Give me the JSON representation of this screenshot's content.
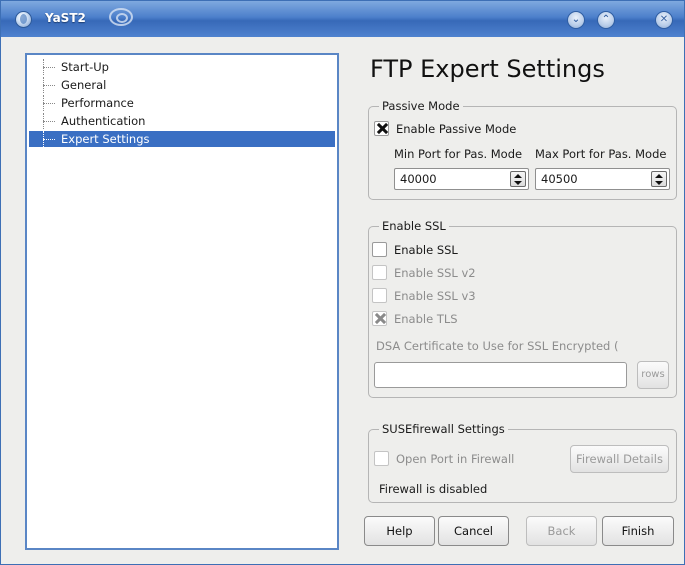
{
  "window": {
    "title": "YaST2"
  },
  "titlebar_buttons": {
    "minimize": "⌄",
    "maximize": "⌃",
    "close": "✕"
  },
  "tree": {
    "items": [
      {
        "label": "Start-Up",
        "selected": false
      },
      {
        "label": "General",
        "selected": false
      },
      {
        "label": "Performance",
        "selected": false
      },
      {
        "label": "Authentication",
        "selected": false
      },
      {
        "label": "Expert Settings",
        "selected": true
      }
    ]
  },
  "heading": "FTP Expert Settings",
  "passive_mode": {
    "group_title": "Passive Mode",
    "enable_label": "Enable Passive Mode",
    "enable_checked": true,
    "min_port_label": "Min Port for Pas. Mode",
    "min_port_value": "40000",
    "max_port_label": "Max Port for Pas. Mode",
    "max_port_value": "40500"
  },
  "ssl": {
    "group_title": "Enable SSL",
    "enable_ssl_label": "Enable SSL",
    "enable_ssl_checked": false,
    "ssl_v2_label": "Enable SSL v2",
    "ssl_v2_checked": false,
    "ssl_v3_label": "Enable SSL v3",
    "ssl_v3_checked": false,
    "tls_label": "Enable TLS",
    "tls_checked": true,
    "cert_label": "DSA Certificate to Use for SSL Encrypted (",
    "cert_value": "",
    "browse_label": "rows"
  },
  "firewall": {
    "group_title": "SUSEfirewall Settings",
    "open_port_label": "Open Port in Firewall",
    "open_port_checked": false,
    "details_button": "Firewall Details",
    "status": "Firewall is disabled"
  },
  "buttons": {
    "help": "Help",
    "cancel": "Cancel",
    "back": "Back",
    "finish": "Finish"
  }
}
